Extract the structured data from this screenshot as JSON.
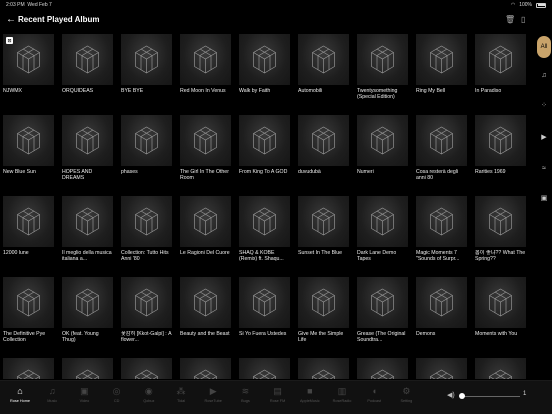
{
  "status": {
    "time": "2:03 PM",
    "date": "Wed Feb 7",
    "battery": "100%"
  },
  "header": {
    "title": "Recent Played Album"
  },
  "albums": [
    "NJWMX",
    "ORQUÍDEAS",
    "BYE BYE",
    "Red Moon In Venus",
    "Walk by Faith",
    "Automobili",
    "Twentysomething (Special Edition)",
    "Ring My Bell",
    "In Paradiso",
    "New Blue Sun",
    "HOPES AND DREAMS",
    "phases",
    "The Girl In The Other Room",
    "From King To A GOD",
    "duvudubà",
    "Numeri",
    "Cosa resterà degli anni 80",
    "Rarities 1969",
    "12000 lune",
    "Il meglio della musica italiana a...",
    "Collection: Tutto Hits Anni '80",
    "Le Ragioni Del Cuore",
    "SHAQ & KOBE (Remix) ft. Shaqu...",
    "Sunset In The Blue",
    "Dark Lane Demo Tapes",
    "Magic Moments 7 \"Sounds of Surpr...",
    "봄이 좋냐?? What The Spring??",
    "The Definitive Pye Collection",
    "OK (feat. Young Thug)",
    "꽃감히 [Kkot-Galpi] : A flower...",
    "Beauty and the Beast",
    "Si Yo Fuera Ustedes",
    "Give Me the Simple Life",
    "Grease (The Original Soundtra...",
    "Demons",
    "Moments with You",
    "",
    "",
    "",
    "",
    "",
    "",
    "",
    "",
    ""
  ],
  "badge_first": "⊡",
  "bottom_tabs": [
    {
      "label": "Rose Home",
      "icon": "home-icon"
    },
    {
      "label": "Music",
      "icon": "music-icon"
    },
    {
      "label": "Video",
      "icon": "video-icon"
    },
    {
      "label": "CD",
      "icon": "cd-icon"
    },
    {
      "label": "Qobuz",
      "icon": "qobuz-icon"
    },
    {
      "label": "Tidal",
      "icon": "tidal-icon"
    },
    {
      "label": "RoseTube",
      "icon": "rosetube-icon"
    },
    {
      "label": "Bugs",
      "icon": "bugs-icon"
    },
    {
      "label": "Rose FM",
      "icon": "radio-icon"
    },
    {
      "label": "AppleMusic",
      "icon": "applemusic-icon"
    },
    {
      "label": "RoseRadio",
      "icon": "roseradio-icon"
    },
    {
      "label": "Podcast",
      "icon": "podcast-icon"
    },
    {
      "label": "Setting",
      "icon": "setting-icon"
    }
  ],
  "volume": {
    "value": "1",
    "level": 0.02
  },
  "sidebar": [
    "all-icon",
    "music-note-icon",
    "tidal-side-icon",
    "video-side-icon",
    "bugs-side-icon",
    "cd-side-icon"
  ]
}
